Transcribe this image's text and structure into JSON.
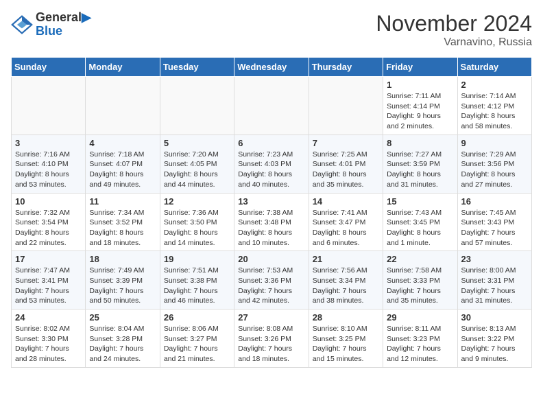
{
  "header": {
    "logo_line1": "General",
    "logo_line2": "Blue",
    "month": "November 2024",
    "location": "Varnavino, Russia"
  },
  "weekdays": [
    "Sunday",
    "Monday",
    "Tuesday",
    "Wednesday",
    "Thursday",
    "Friday",
    "Saturday"
  ],
  "weeks": [
    [
      {
        "day": "",
        "info": ""
      },
      {
        "day": "",
        "info": ""
      },
      {
        "day": "",
        "info": ""
      },
      {
        "day": "",
        "info": ""
      },
      {
        "day": "",
        "info": ""
      },
      {
        "day": "1",
        "info": "Sunrise: 7:11 AM\nSunset: 4:14 PM\nDaylight: 9 hours\nand 2 minutes."
      },
      {
        "day": "2",
        "info": "Sunrise: 7:14 AM\nSunset: 4:12 PM\nDaylight: 8 hours\nand 58 minutes."
      }
    ],
    [
      {
        "day": "3",
        "info": "Sunrise: 7:16 AM\nSunset: 4:10 PM\nDaylight: 8 hours\nand 53 minutes."
      },
      {
        "day": "4",
        "info": "Sunrise: 7:18 AM\nSunset: 4:07 PM\nDaylight: 8 hours\nand 49 minutes."
      },
      {
        "day": "5",
        "info": "Sunrise: 7:20 AM\nSunset: 4:05 PM\nDaylight: 8 hours\nand 44 minutes."
      },
      {
        "day": "6",
        "info": "Sunrise: 7:23 AM\nSunset: 4:03 PM\nDaylight: 8 hours\nand 40 minutes."
      },
      {
        "day": "7",
        "info": "Sunrise: 7:25 AM\nSunset: 4:01 PM\nDaylight: 8 hours\nand 35 minutes."
      },
      {
        "day": "8",
        "info": "Sunrise: 7:27 AM\nSunset: 3:59 PM\nDaylight: 8 hours\nand 31 minutes."
      },
      {
        "day": "9",
        "info": "Sunrise: 7:29 AM\nSunset: 3:56 PM\nDaylight: 8 hours\nand 27 minutes."
      }
    ],
    [
      {
        "day": "10",
        "info": "Sunrise: 7:32 AM\nSunset: 3:54 PM\nDaylight: 8 hours\nand 22 minutes."
      },
      {
        "day": "11",
        "info": "Sunrise: 7:34 AM\nSunset: 3:52 PM\nDaylight: 8 hours\nand 18 minutes."
      },
      {
        "day": "12",
        "info": "Sunrise: 7:36 AM\nSunset: 3:50 PM\nDaylight: 8 hours\nand 14 minutes."
      },
      {
        "day": "13",
        "info": "Sunrise: 7:38 AM\nSunset: 3:48 PM\nDaylight: 8 hours\nand 10 minutes."
      },
      {
        "day": "14",
        "info": "Sunrise: 7:41 AM\nSunset: 3:47 PM\nDaylight: 8 hours\nand 6 minutes."
      },
      {
        "day": "15",
        "info": "Sunrise: 7:43 AM\nSunset: 3:45 PM\nDaylight: 8 hours\nand 1 minute."
      },
      {
        "day": "16",
        "info": "Sunrise: 7:45 AM\nSunset: 3:43 PM\nDaylight: 7 hours\nand 57 minutes."
      }
    ],
    [
      {
        "day": "17",
        "info": "Sunrise: 7:47 AM\nSunset: 3:41 PM\nDaylight: 7 hours\nand 53 minutes."
      },
      {
        "day": "18",
        "info": "Sunrise: 7:49 AM\nSunset: 3:39 PM\nDaylight: 7 hours\nand 50 minutes."
      },
      {
        "day": "19",
        "info": "Sunrise: 7:51 AM\nSunset: 3:38 PM\nDaylight: 7 hours\nand 46 minutes."
      },
      {
        "day": "20",
        "info": "Sunrise: 7:53 AM\nSunset: 3:36 PM\nDaylight: 7 hours\nand 42 minutes."
      },
      {
        "day": "21",
        "info": "Sunrise: 7:56 AM\nSunset: 3:34 PM\nDaylight: 7 hours\nand 38 minutes."
      },
      {
        "day": "22",
        "info": "Sunrise: 7:58 AM\nSunset: 3:33 PM\nDaylight: 7 hours\nand 35 minutes."
      },
      {
        "day": "23",
        "info": "Sunrise: 8:00 AM\nSunset: 3:31 PM\nDaylight: 7 hours\nand 31 minutes."
      }
    ],
    [
      {
        "day": "24",
        "info": "Sunrise: 8:02 AM\nSunset: 3:30 PM\nDaylight: 7 hours\nand 28 minutes."
      },
      {
        "day": "25",
        "info": "Sunrise: 8:04 AM\nSunset: 3:28 PM\nDaylight: 7 hours\nand 24 minutes."
      },
      {
        "day": "26",
        "info": "Sunrise: 8:06 AM\nSunset: 3:27 PM\nDaylight: 7 hours\nand 21 minutes."
      },
      {
        "day": "27",
        "info": "Sunrise: 8:08 AM\nSunset: 3:26 PM\nDaylight: 7 hours\nand 18 minutes."
      },
      {
        "day": "28",
        "info": "Sunrise: 8:10 AM\nSunset: 3:25 PM\nDaylight: 7 hours\nand 15 minutes."
      },
      {
        "day": "29",
        "info": "Sunrise: 8:11 AM\nSunset: 3:23 PM\nDaylight: 7 hours\nand 12 minutes."
      },
      {
        "day": "30",
        "info": "Sunrise: 8:13 AM\nSunset: 3:22 PM\nDaylight: 7 hours\nand 9 minutes."
      }
    ]
  ]
}
